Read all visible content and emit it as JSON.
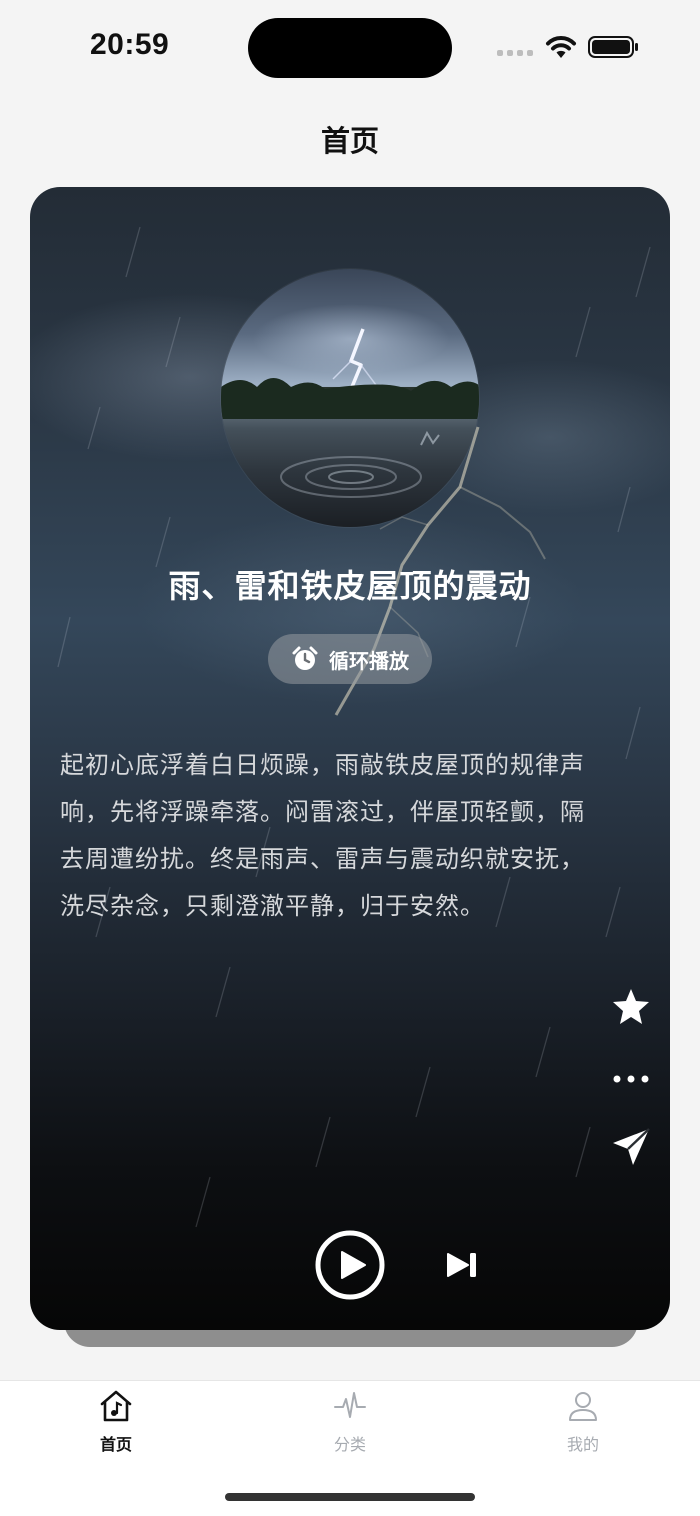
{
  "status_bar": {
    "time": "20:59"
  },
  "header": {
    "title": "首页"
  },
  "player": {
    "track_title": "雨、雷和铁皮屋顶的震动",
    "loop_label": "循环播放",
    "description": "起初心底浮着白日烦躁，雨敲铁皮屋顶的规律声响，先将浮躁牵落。闷雷滚过，伴屋顶轻颤，隔去周遭纷扰。终是雨声、雷声与震动织就安抚，洗尽杂念，只剩澄澈平静，归于安然。",
    "side_actions": [
      "star-icon",
      "more-icon",
      "share-icon"
    ],
    "controls": [
      "play-icon",
      "next-track-icon"
    ]
  },
  "tab_bar": {
    "tabs": [
      {
        "label": "首页",
        "icon": "home-music-icon",
        "active": true
      },
      {
        "label": "分类",
        "icon": "pulse-icon",
        "active": false
      },
      {
        "label": "我的",
        "icon": "profile-icon",
        "active": false
      }
    ]
  }
}
